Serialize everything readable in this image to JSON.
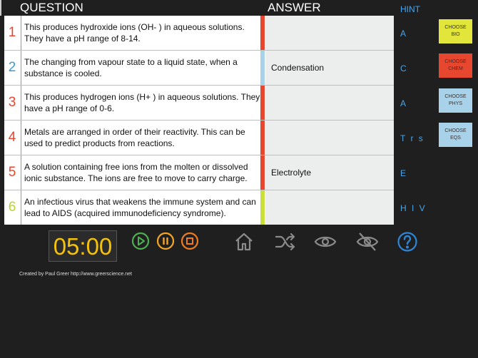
{
  "header": {
    "question": "QUESTION",
    "answer": "ANSWER",
    "hint": "HINT"
  },
  "rows": [
    {
      "num": "1",
      "color": "#e8472f",
      "bar": "#e8472f",
      "question": "This produces hydroxide ions (OH- ) in aqueous solutions. They have a pH range of 8-14.",
      "answer": "",
      "hint": "A"
    },
    {
      "num": "2",
      "color": "#3b9bd1",
      "bar": "#a7d2ea",
      "question": "The changing from vapour state to a liquid state, when a substance is cooled.",
      "answer": "Condensation",
      "hint": "C"
    },
    {
      "num": "3",
      "color": "#e8472f",
      "bar": "#e8472f",
      "question": "This produces hydrogen ions (H+ ) in aqueous solutions. They have a pH range of 0-6.",
      "answer": "",
      "hint": "A"
    },
    {
      "num": "4",
      "color": "#e8472f",
      "bar": "#e8472f",
      "question": "Metals are arranged in order of their reactivity. This can be used to predict products from reactions.",
      "answer": "",
      "hint": "T r s"
    },
    {
      "num": "5",
      "color": "#e8472f",
      "bar": "#e8472f",
      "question": "A solution containing free ions from the molten or dissolved ionic substance. The ions are free to move to carry charge.",
      "answer": "Electrolyte",
      "hint": "E"
    },
    {
      "num": "6",
      "color": "#b9d334",
      "bar": "#c9df3a",
      "question": "An infectious virus that weakens the immune system and can lead to AIDS (acquired immunodeficiency syndrome).",
      "answer": "",
      "hint": "H I V"
    }
  ],
  "choose": [
    {
      "label": "CHOOSE BIO",
      "color": "#e3e63a"
    },
    {
      "label": "CHOOSE CHEM",
      "color": "#e8472f"
    },
    {
      "label": "CHOOSE PHYS",
      "color": "#a7d2ea"
    },
    {
      "label": "CHOOSE EQS",
      "color": "#a7d2ea"
    }
  ],
  "timer": "05:00",
  "controls": {
    "play_color": "#4caf50",
    "pause_color": "#f5a623",
    "stop_color": "#f07c1e",
    "tool_color": "#8a8a8a",
    "help_color": "#2f86d6"
  },
  "icons": [
    "play-icon",
    "pause-icon",
    "stop-icon",
    "home-icon",
    "shuffle-icon",
    "eye-icon",
    "eye-off-icon",
    "help-icon"
  ],
  "credit": "Created by Paul Greer http://www.greerscience.net"
}
